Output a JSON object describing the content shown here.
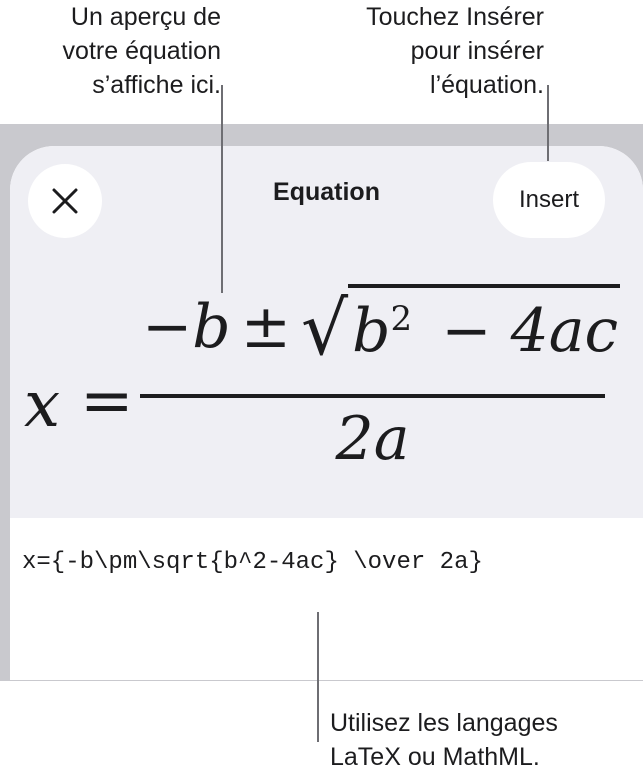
{
  "callouts": {
    "preview": [
      "Un aperçu de",
      "votre équation",
      "s’affiche ici."
    ],
    "insert": [
      "Touchez Insérer",
      "pour insérer",
      "l’équation."
    ],
    "languages": [
      "Utilisez les langages",
      "LaTeX ou MathML."
    ]
  },
  "sheet": {
    "title": "Equation",
    "insert_label": "Insert",
    "close_icon": "close-icon"
  },
  "equation_preview": {
    "lhs": "x",
    "equals": "=",
    "num_minus_b": "−b",
    "pm": "±",
    "radicand_b": "b",
    "exponent": "2",
    "radicand_rest": "− 4ac",
    "denominator": "2a"
  },
  "source_text": "x={-b\\pm\\sqrt{b^2-4ac} \\over 2a}",
  "colors": {
    "band": "#c9c9ce",
    "preview_bg": "#efeff4",
    "leader": "#6e6e73"
  }
}
